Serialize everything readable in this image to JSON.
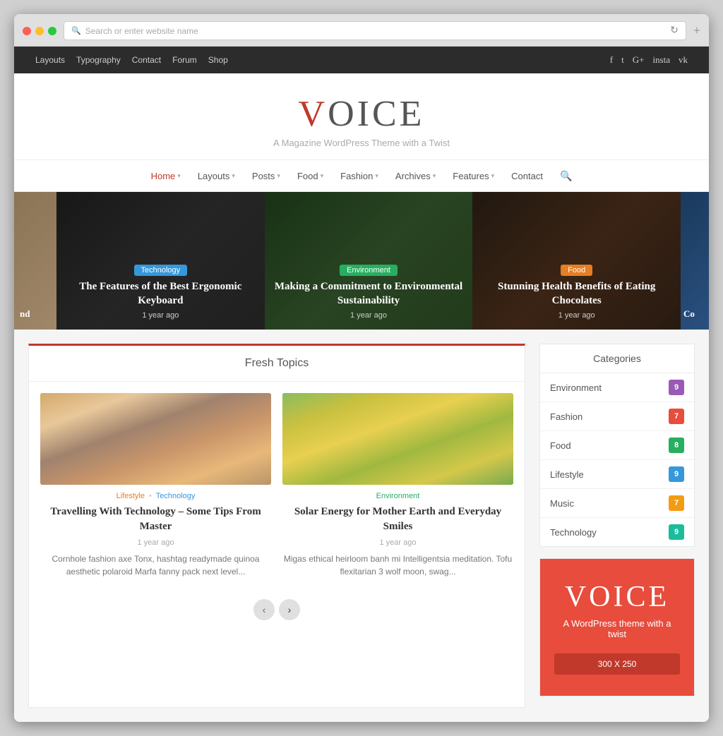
{
  "browser": {
    "address_placeholder": "Search or enter website name"
  },
  "top_nav": {
    "links": [
      "Layouts",
      "Typography",
      "Contact",
      "Forum",
      "Shop"
    ],
    "social": [
      "f",
      "t",
      "G+",
      "insta",
      "vk"
    ]
  },
  "header": {
    "logo_v": "V",
    "logo_rest": "OICE",
    "tagline": "A Magazine WordPress Theme with a Twist"
  },
  "main_nav": {
    "items": [
      {
        "label": "Home",
        "active": true,
        "has_dropdown": true
      },
      {
        "label": "Layouts",
        "active": false,
        "has_dropdown": true
      },
      {
        "label": "Posts",
        "active": false,
        "has_dropdown": true
      },
      {
        "label": "Food",
        "active": false,
        "has_dropdown": true
      },
      {
        "label": "Fashion",
        "active": false,
        "has_dropdown": true
      },
      {
        "label": "Archives",
        "active": false,
        "has_dropdown": true
      },
      {
        "label": "Features",
        "active": false,
        "has_dropdown": true
      },
      {
        "label": "Contact",
        "active": false,
        "has_dropdown": false
      }
    ]
  },
  "hero": {
    "edge_left_text": "nd",
    "edge_right_text": "Co",
    "slides": [
      {
        "badge": "Technology",
        "badge_class": "badge-tech",
        "title": "The Features of the Best Ergonomic Keyboard",
        "date": "1 year ago",
        "bg_class": "slide-bg-1"
      },
      {
        "badge": "Environment",
        "badge_class": "badge-env",
        "title": "Making a Commitment to Environmental Sustainability",
        "date": "1 year ago",
        "bg_class": "slide-bg-2"
      },
      {
        "badge": "Food",
        "badge_class": "badge-food",
        "title": "Stunning Health Benefits of Eating Chocolates",
        "date": "1 year ago",
        "bg_class": "slide-bg-3"
      }
    ]
  },
  "fresh_topics": {
    "header": "Fresh Topics",
    "articles": [
      {
        "cats": [
          {
            "label": "Lifestyle",
            "class": "cat-lifestyle"
          },
          {
            "label": "Technology",
            "class": "cat-technology"
          }
        ],
        "title": "Travelling With Technology – Some Tips From Master",
        "date": "1 year ago",
        "excerpt": "Cornhole fashion axe Tonx, hashtag readymade quinoa aesthetic polaroid Marfa fanny pack next level...",
        "thumb_class": "thumb-tech"
      },
      {
        "cats": [
          {
            "label": "Environment",
            "class": "cat-environment"
          }
        ],
        "title": "Solar Energy for Mother Earth and Everyday Smiles",
        "date": "1 year ago",
        "excerpt": "Migas ethical heirloom banh mi Intelligentsia meditation. Tofu flexitarian 3 wolf moon, swag...",
        "thumb_class": "thumb-env"
      }
    ],
    "pagination": {
      "prev": "‹",
      "next": "›"
    }
  },
  "sidebar": {
    "categories_header": "Categories",
    "categories": [
      {
        "name": "Environment",
        "count": "9",
        "count_class": "count-purple"
      },
      {
        "name": "Fashion",
        "count": "7",
        "count_class": "count-red"
      },
      {
        "name": "Food",
        "count": "8",
        "count_class": "count-green"
      },
      {
        "name": "Lifestyle",
        "count": "9",
        "count_class": "count-blue"
      },
      {
        "name": "Music",
        "count": "7",
        "count_class": "count-yellow"
      },
      {
        "name": "Technology",
        "count": "9",
        "count_class": "count-teal"
      }
    ],
    "ad": {
      "logo_v": "V",
      "logo_rest": "OICE",
      "tagline": "A WordPress theme with a twist",
      "size": "300 X 250"
    }
  }
}
